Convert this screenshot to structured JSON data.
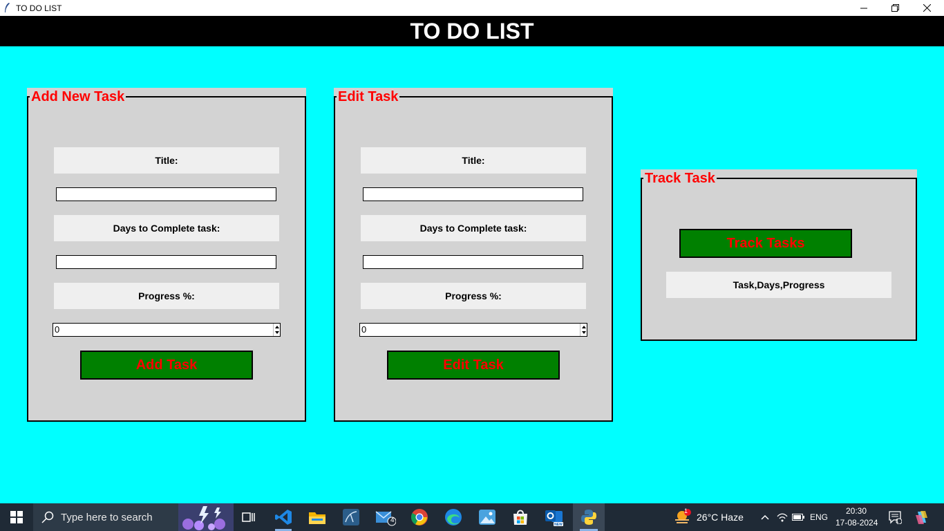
{
  "window": {
    "title": "TO DO LIST"
  },
  "header": {
    "title": "TO DO LIST"
  },
  "add_panel": {
    "legend": "Add New Task",
    "title_label": "Title:",
    "title_value": "",
    "days_label": "Days to Complete task:",
    "days_value": "",
    "progress_label": "Progress %:",
    "progress_value": "0",
    "button": "Add Task"
  },
  "edit_panel": {
    "legend": "Edit Task",
    "title_label": "Title:",
    "title_value": "",
    "days_label": "Days to Complete task:",
    "days_value": "",
    "progress_label": "Progress %:",
    "progress_value": "0",
    "button": "Edit Task"
  },
  "track_panel": {
    "legend": "Track Task",
    "button": "Track Tasks",
    "output": "Task,Days,Progress"
  },
  "taskbar": {
    "search_placeholder": "Type here to search",
    "apps": [
      "start-icon",
      "search-icon",
      "task-view-icon",
      "vscode-icon",
      "file-explorer-icon",
      "mysql-workbench-icon",
      "mail-icon",
      "chrome-icon",
      "edge-icon",
      "photos-icon",
      "store-icon",
      "outlook-icon",
      "python-icon"
    ],
    "mail_badge": "4",
    "weather_badge": "1",
    "weather": "26°C  Haze",
    "language": "ENG",
    "time": "20:30",
    "date": "17-08-2024",
    "notification_count": "1"
  },
  "colors": {
    "background": "#00ffff",
    "header_bg": "#000000",
    "panel_bg": "#d3d3d3",
    "button_bg": "#008000",
    "accent_text": "#ff0000"
  }
}
